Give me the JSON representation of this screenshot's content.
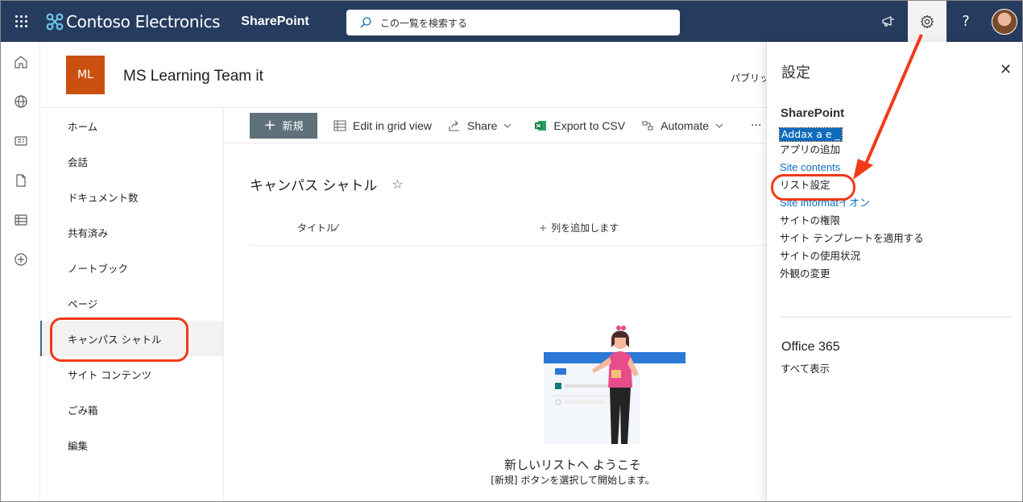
{
  "suitebar": {
    "brand": "Contoso Electronics",
    "app_name": "SharePoint",
    "search_placeholder": "この一覧を検索する",
    "help": "?"
  },
  "site": {
    "logo_initials": "ML",
    "title": "MS Learning Team it",
    "visibility": "パブリック"
  },
  "nav": {
    "items": [
      {
        "label": "ホーム"
      },
      {
        "label": "会話"
      },
      {
        "label": "ドキュメント数"
      },
      {
        "label": "共有済み"
      },
      {
        "label": "ノートブック"
      },
      {
        "label": "ページ"
      },
      {
        "label": "キャンパス シャトル",
        "selected": true
      },
      {
        "label": "サイト コンテンツ"
      },
      {
        "label": "ごみ箱"
      },
      {
        "label": "編集"
      }
    ]
  },
  "commandbar": {
    "new_label": "新規",
    "grid_label": "Edit in grid view",
    "share_label": "Share",
    "export_label": "Export to CSV",
    "automate_label": "Automate",
    "more": "···"
  },
  "list": {
    "title": "キャンパス シャトル",
    "columns": {
      "title": "タイトル",
      "add_column": "列を追加します"
    },
    "empty_title": "新しいリストへ ようこそ",
    "empty_subtitle": "[新規] ボタンを選択して開始します。"
  },
  "settings_panel": {
    "title": "設定",
    "section": "SharePoint",
    "links": [
      {
        "label": "Addax a e _",
        "style": "sel"
      },
      {
        "label": "アプリの追加",
        "style": ""
      },
      {
        "label": "Site contents",
        "style": "blue"
      },
      {
        "label": "リスト設定",
        "style": ""
      },
      {
        "label": "Site informatイオン",
        "style": "blue"
      },
      {
        "label": "サイトの権限",
        "style": ""
      },
      {
        "label": "サイト テンプレートを適用する",
        "style": ""
      },
      {
        "label": "サイトの使用状況",
        "style": ""
      },
      {
        "label": "外観の変更",
        "style": ""
      }
    ],
    "o365_title": "Office 365",
    "view_all": "すべて表示"
  },
  "colors": {
    "suitebar": "#263c5f",
    "site_logo": "#ca5010",
    "callout": "#f03a17",
    "link": "#0f6cbd"
  }
}
